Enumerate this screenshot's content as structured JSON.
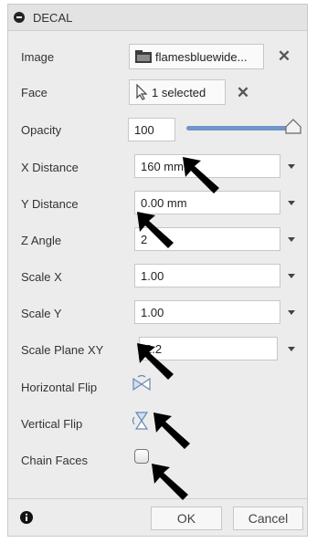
{
  "header": {
    "title": "DECAL"
  },
  "rows": {
    "image": {
      "label": "Image",
      "value": "flamesbluewide..."
    },
    "face": {
      "label": "Face",
      "value": "1 selected"
    },
    "opacity": {
      "label": "Opacity",
      "value": "100",
      "slider_percent": 100
    },
    "x_distance": {
      "label": "X Distance",
      "value": "160 mm"
    },
    "y_distance": {
      "label": "Y Distance",
      "value": "0.00 mm"
    },
    "z_angle": {
      "label": "Z Angle",
      "value": "2"
    },
    "scale_x": {
      "label": "Scale X",
      "value": "1.00"
    },
    "scale_y": {
      "label": "Scale Y",
      "value": "1.00"
    },
    "scale_plane_xy": {
      "label": "Scale Plane XY",
      "value": "2.2"
    },
    "horizontal_flip": {
      "label": "Horizontal Flip"
    },
    "vertical_flip": {
      "label": "Vertical Flip"
    },
    "chain_faces": {
      "label": "Chain Faces",
      "checked": false
    }
  },
  "footer": {
    "ok_label": "OK",
    "cancel_label": "Cancel"
  },
  "icons": {
    "clear": "✕",
    "collapse": "collapse-icon",
    "info": "info-icon",
    "cursor": "cursor-icon",
    "folder": "image-folder-icon",
    "arrows": "black-pointer-arrow-icon"
  },
  "colors": {
    "accent": "#6f95c9",
    "panel_bg": "#ececec"
  }
}
